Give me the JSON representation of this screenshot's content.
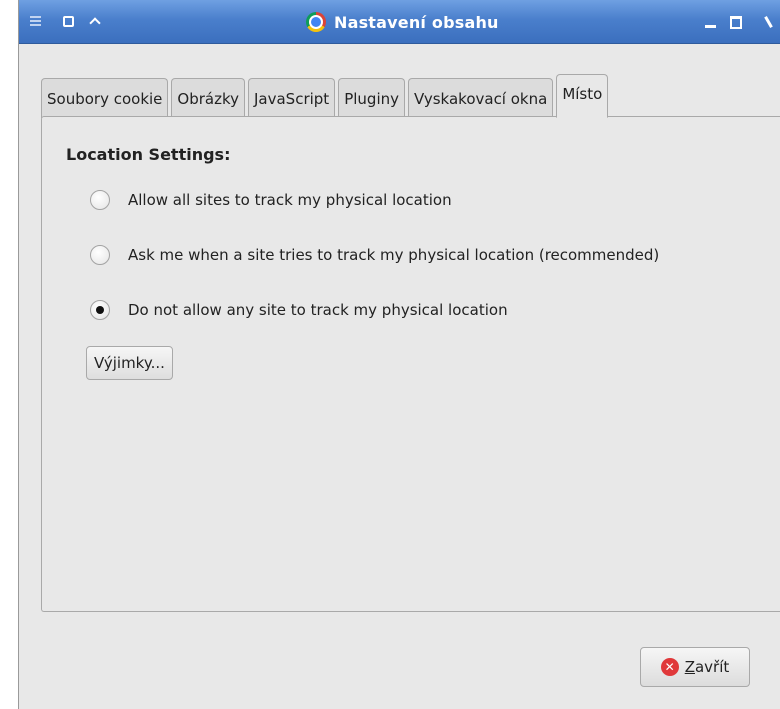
{
  "window": {
    "title": "Nastavení obsahu"
  },
  "tabs": [
    {
      "label": "Soubory cookie",
      "active": false
    },
    {
      "label": "Obrázky",
      "active": false
    },
    {
      "label": "JavaScript",
      "active": false
    },
    {
      "label": "Pluginy",
      "active": false
    },
    {
      "label": "Vyskakovací okna",
      "active": false
    },
    {
      "label": "Místo",
      "active": true
    }
  ],
  "location": {
    "section_title": "Location Settings:",
    "options": [
      {
        "label": "Allow all sites to track my physical location",
        "checked": false
      },
      {
        "label": "Ask me when a site tries to track my physical location (recommended)",
        "checked": false
      },
      {
        "label": "Do not allow any site to track my physical location",
        "checked": true
      }
    ],
    "exceptions_label": "Výjimky..."
  },
  "footer": {
    "close_mnemonic": "Z",
    "close_rest": "avřít"
  },
  "colors": {
    "titlebar": "#4a7fcc",
    "dialog_bg": "#e8e8e8",
    "close_icon": "#e0383a"
  }
}
